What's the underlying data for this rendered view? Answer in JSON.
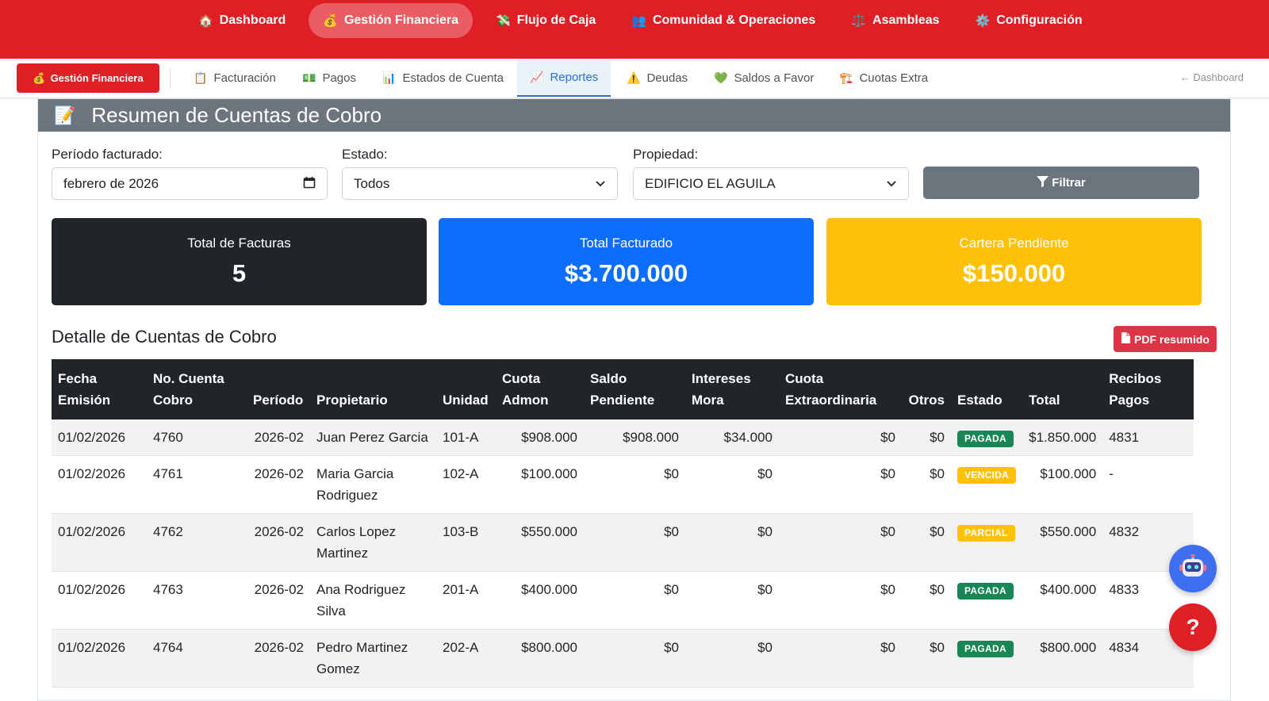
{
  "topnav": {
    "items": [
      {
        "icon": "🏠",
        "label": "Dashboard"
      },
      {
        "icon": "💰",
        "label": "Gestión Financiera"
      },
      {
        "icon": "💸",
        "label": "Flujo de Caja"
      },
      {
        "icon": "👥",
        "label": "Comunidad & Operaciones"
      },
      {
        "icon": "⚖️",
        "label": "Asambleas"
      },
      {
        "icon": "⚙️",
        "label": "Configuración"
      }
    ]
  },
  "subnav": {
    "brand": {
      "icon": "💰",
      "label": "Gestión Financiera"
    },
    "tabs": [
      {
        "icon": "📋",
        "label": "Facturación"
      },
      {
        "icon": "💵",
        "label": "Pagos"
      },
      {
        "icon": "📊",
        "label": "Estados de Cuenta"
      },
      {
        "icon": "📈",
        "label": "Reportes"
      },
      {
        "icon": "⚠️",
        "label": "Deudas"
      },
      {
        "icon": "💚",
        "label": "Saldos a Favor"
      },
      {
        "icon": "🏗️",
        "label": "Cuotas Extra"
      }
    ],
    "back_label": "← Dashboard"
  },
  "card": {
    "icon": "📝",
    "title": "Resumen de Cuentas de Cobro"
  },
  "filters": {
    "periodo_label": "Período facturado:",
    "periodo_value": "febrero de 2026",
    "estado_label": "Estado:",
    "estado_value": "Todos",
    "propiedad_label": "Propiedad:",
    "propiedad_value": "EDIFICIO EL AGUILA",
    "filter_button": "Filtrar"
  },
  "stats": {
    "total_facturas_label": "Total de Facturas",
    "total_facturas_value": "5",
    "total_facturado_label": "Total Facturado",
    "total_facturado_value": "$3.700.000",
    "cartera_label": "Cartera Pendiente",
    "cartera_value": "$150.000"
  },
  "detail": {
    "title": "Detalle de Cuentas de Cobro",
    "pdf_button": "PDF resumido"
  },
  "table": {
    "headers": [
      "Fecha Emisión",
      "No. Cuenta Cobro",
      "Período",
      "Propietario",
      "Unidad",
      "Cuota Admon",
      "Saldo Pendiente",
      "Intereses Mora",
      "Cuota Extraordinaria",
      "Otros",
      "Estado",
      "Total",
      "Recibos Pagos"
    ],
    "rows": [
      {
        "fecha": "01/02/2026",
        "numero": "4760",
        "periodo": "2026-02",
        "propietario": "Juan Perez Garcia",
        "unidad": "101-A",
        "cuota": "$908.000",
        "saldo": "$908.000",
        "intereses": "$34.000",
        "extra": "$0",
        "otros": "$0",
        "estado": "PAGADA",
        "estado_color": "#198754",
        "total": "$1.850.000",
        "recibos": "4831"
      },
      {
        "fecha": "01/02/2026",
        "numero": "4761",
        "periodo": "2026-02",
        "propietario": "Maria Garcia Rodriguez",
        "unidad": "102-A",
        "cuota": "$100.000",
        "saldo": "$0",
        "intereses": "$0",
        "extra": "$0",
        "otros": "$0",
        "estado": "VENCIDA",
        "estado_color": "#ffc107",
        "total": "$100.000",
        "recibos": "-"
      },
      {
        "fecha": "01/02/2026",
        "numero": "4762",
        "periodo": "2026-02",
        "propietario": "Carlos Lopez Martinez",
        "unidad": "103-B",
        "cuota": "$550.000",
        "saldo": "$0",
        "intereses": "$0",
        "extra": "$0",
        "otros": "$0",
        "estado": "PARCIAL",
        "estado_color": "#ffc107",
        "total": "$550.000",
        "recibos": "4832"
      },
      {
        "fecha": "01/02/2026",
        "numero": "4763",
        "periodo": "2026-02",
        "propietario": "Ana Rodriguez Silva",
        "unidad": "201-A",
        "cuota": "$400.000",
        "saldo": "$0",
        "intereses": "$0",
        "extra": "$0",
        "otros": "$0",
        "estado": "PAGADA",
        "estado_color": "#198754",
        "total": "$400.000",
        "recibos": "4833"
      },
      {
        "fecha": "01/02/2026",
        "numero": "4764",
        "periodo": "2026-02",
        "propietario": "Pedro Martinez Gomez",
        "unidad": "202-A",
        "cuota": "$800.000",
        "saldo": "$0",
        "intereses": "$0",
        "extra": "$0",
        "otros": "$0",
        "estado": "PAGADA",
        "estado_color": "#198754",
        "total": "$800.000",
        "recibos": "4834"
      }
    ]
  },
  "fabs": {
    "help_label": "?"
  }
}
